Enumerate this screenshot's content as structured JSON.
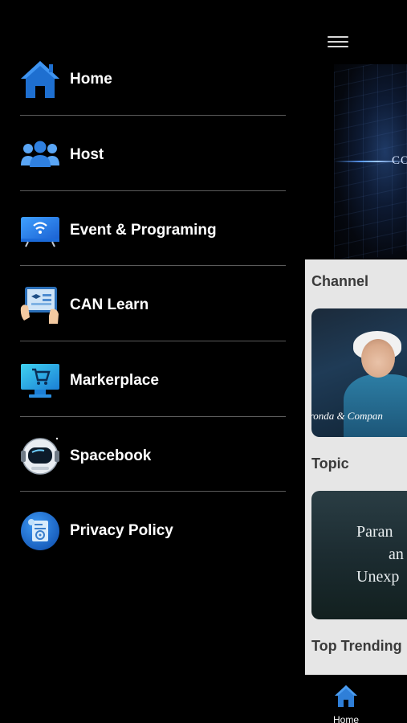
{
  "menu": {
    "items": [
      {
        "label": "Home",
        "icon": "home-icon"
      },
      {
        "label": "Host",
        "icon": "users-icon"
      },
      {
        "label": "Event & Programing",
        "icon": "tv-icon"
      },
      {
        "label": "CAN Learn",
        "icon": "tablet-learn-icon"
      },
      {
        "label": "Markerplace",
        "icon": "shopping-cart-icon"
      },
      {
        "label": "Spacebook",
        "icon": "astronaut-helmet-icon"
      },
      {
        "label": "Privacy Policy",
        "icon": "privacy-policy-icon"
      }
    ]
  },
  "background": {
    "hero_text": "CO",
    "sections": {
      "channel": "Channel",
      "topic": "Topic",
      "trending": "Top Trending"
    },
    "channel_card_caption": "ironda & Compan",
    "topic_card_lines": [
      "Paran",
      "an",
      "Unexp"
    ],
    "tabbar": {
      "home_label": "Home"
    }
  },
  "colors": {
    "accent_blue": "#2f7fd8",
    "content_bg": "#e6e6e6",
    "divider": "#5a5a5a"
  }
}
